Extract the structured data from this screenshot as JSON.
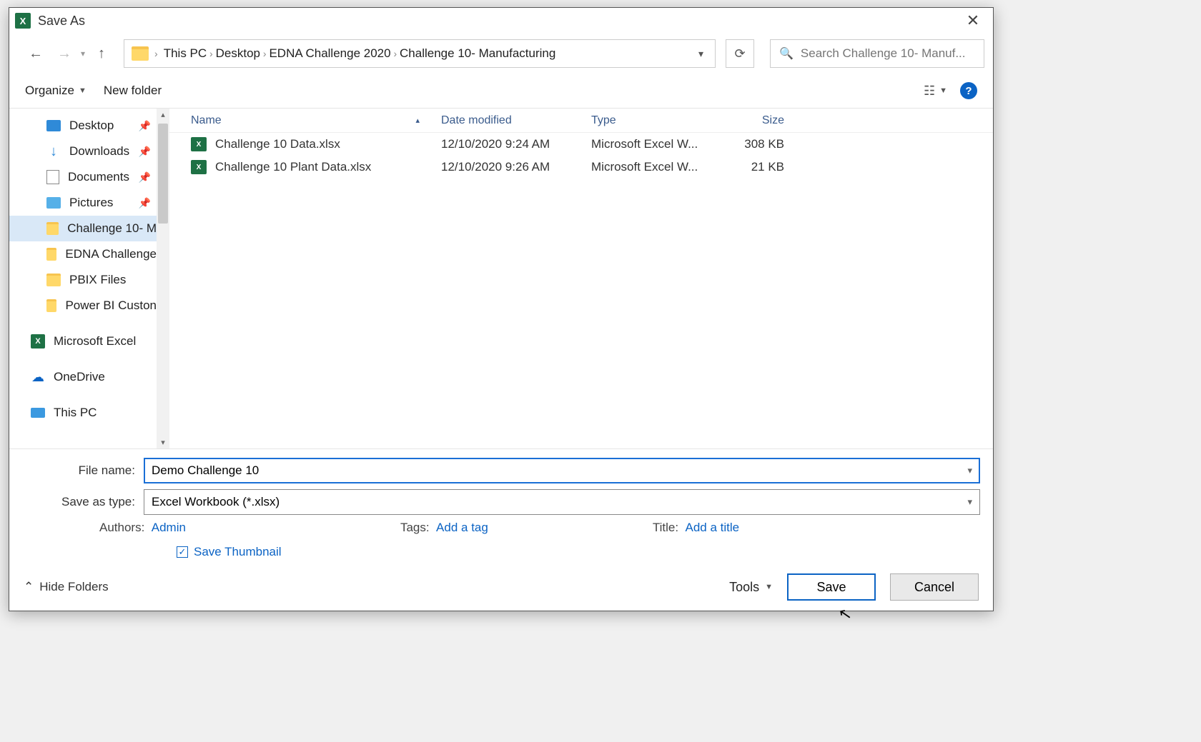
{
  "title": "Save As",
  "breadcrumbs": [
    "This PC",
    "Desktop",
    "EDNA Challenge 2020",
    "Challenge 10- Manufacturing"
  ],
  "search": {
    "placeholder": "Search Challenge 10- Manuf..."
  },
  "toolbar": {
    "organize": "Organize",
    "newfolder": "New folder"
  },
  "sidebar": {
    "items": [
      {
        "icon": "desktop",
        "label": "Desktop",
        "pinned": true
      },
      {
        "icon": "dl",
        "label": "Downloads",
        "pinned": true
      },
      {
        "icon": "doc",
        "label": "Documents",
        "pinned": true
      },
      {
        "icon": "pic",
        "label": "Pictures",
        "pinned": true
      },
      {
        "icon": "folder",
        "label": "Challenge 10- M",
        "selected": true
      },
      {
        "icon": "folder",
        "label": "EDNA Challenge"
      },
      {
        "icon": "folder",
        "label": "PBIX Files"
      },
      {
        "icon": "folder",
        "label": "Power BI Custon"
      }
    ],
    "roots": [
      {
        "icon": "excel",
        "label": "Microsoft Excel"
      },
      {
        "icon": "od",
        "label": "OneDrive"
      },
      {
        "icon": "pc",
        "label": "This PC"
      }
    ]
  },
  "columns": {
    "name": "Name",
    "date": "Date modified",
    "type": "Type",
    "size": "Size"
  },
  "files": [
    {
      "name": "Challenge 10 Data.xlsx",
      "date": "12/10/2020 9:24 AM",
      "type": "Microsoft Excel W...",
      "size": "308 KB"
    },
    {
      "name": "Challenge 10 Plant Data.xlsx",
      "date": "12/10/2020 9:26 AM",
      "type": "Microsoft Excel W...",
      "size": "21 KB"
    }
  ],
  "form": {
    "filename_label": "File name:",
    "filename_value": "Demo Challenge 10",
    "savetype_label": "Save as type:",
    "savetype_value": "Excel Workbook (*.xlsx)",
    "authors_label": "Authors:",
    "authors_value": "Admin",
    "tags_label": "Tags:",
    "tags_value": "Add a tag",
    "title_label": "Title:",
    "title_value": "Add a title",
    "thumb_label": "Save Thumbnail",
    "thumb_checked": true
  },
  "footer": {
    "hide": "Hide Folders",
    "tools": "Tools",
    "save": "Save",
    "cancel": "Cancel"
  }
}
